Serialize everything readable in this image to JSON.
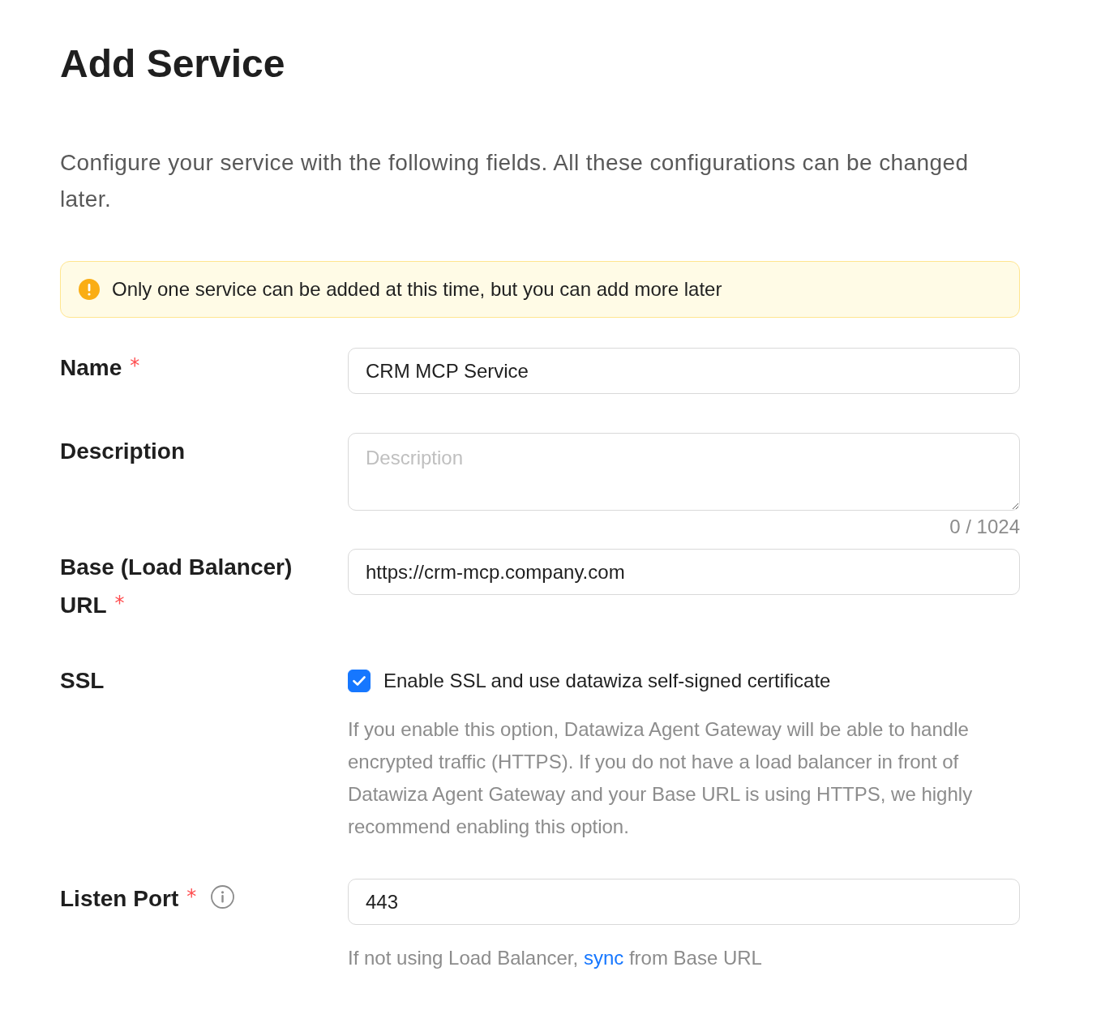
{
  "title": "Add Service",
  "intro": "Configure your service with the following fields. All these configurations can be changed later.",
  "alert": {
    "kind": "warning",
    "message": "Only one service can be added at this time, but you can add more later"
  },
  "fields": [
    {
      "kind": "input",
      "label": "Name",
      "required_mark": "*",
      "value": "CRM MCP Service"
    },
    {
      "kind": "textarea",
      "label": "Description",
      "placeholder": "Description",
      "counter": "0 / 1024"
    },
    {
      "kind": "input",
      "label": "Base (Load Balancer) URL",
      "required_mark": "*",
      "value": "https://crm-mcp.company.com"
    },
    {
      "kind": "checkbox",
      "label": "SSL",
      "checked": true,
      "option": "Enable SSL and use datawiza self-signed certificate",
      "help": {
        "text": "If you enable this option, Datawiza Agent Gateway will be able to handle encrypted traffic (HTTPS). If you do not have a load balancer in front of Datawiza Agent Gateway and your Base URL is using HTTPS, we highly recommend enabling this option."
      }
    },
    {
      "kind": "input",
      "label": "Listen Port",
      "required_mark": "*",
      "info": true,
      "value": "443",
      "help": {
        "text": "If not using Load Balancer, ",
        "link": "sync",
        "text_after": " from Base URL"
      }
    }
  ]
}
